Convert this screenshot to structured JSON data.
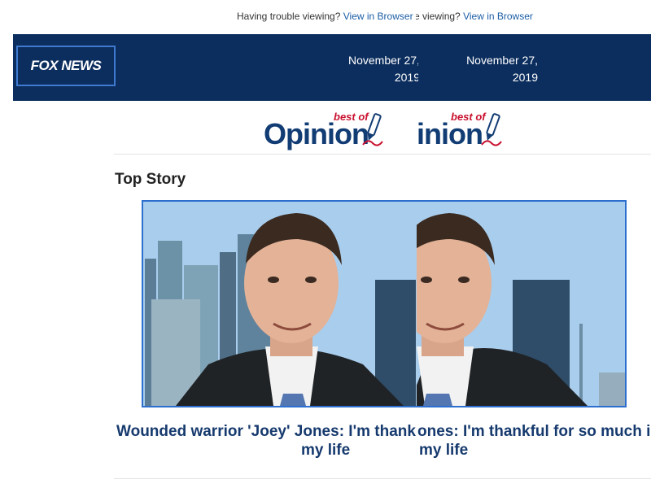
{
  "top_note": {
    "text": "Having trouble viewing?",
    "link": "View in Browser",
    "dup_text_fragment": "viewing?",
    "dup_link": "View in Browser"
  },
  "header": {
    "logo_text": "FOX NEWS",
    "date_line1": "November 27,",
    "date_line2": "2019"
  },
  "brand": {
    "word": "Opinion",
    "word_dup": "inion",
    "best_of": "best of"
  },
  "main": {
    "section_title": "Top Story",
    "headline_line1_left": "Wounded warrior 'Joey' Jones: I'm thank",
    "headline_line1_right": "ones: I'm thankful for so much in",
    "headline_line2": "my life"
  },
  "colors": {
    "header_bg": "#0c2e5e",
    "link": "#1a5da6",
    "headline": "#163a6e",
    "best_of_red": "#c8102e"
  },
  "icons": [
    "pen-icon",
    "fox-news-logo"
  ]
}
